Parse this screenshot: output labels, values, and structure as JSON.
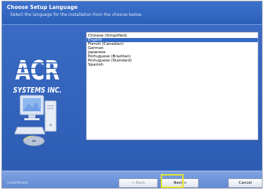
{
  "header": {
    "title": "Choose Setup Language",
    "subtitle": "Select the language for the installation from the choices below."
  },
  "logo": {
    "line1": "ACR",
    "line2": "SYSTEMS INC."
  },
  "languages": [
    "Chinese (Simplified)",
    "English",
    "French (Canadian)",
    "German",
    "Japanese",
    "Portuguese (Brazilian)",
    "Portuguese (Standard)",
    "Spanish"
  ],
  "selected_language": "English",
  "footer": {
    "installshield": "InstallShield",
    "back_label": "< Back",
    "next_label": "Next >",
    "cancel_label": "Cancel"
  },
  "colors": {
    "accent": "#316ac5",
    "highlight": "#e8e628"
  }
}
